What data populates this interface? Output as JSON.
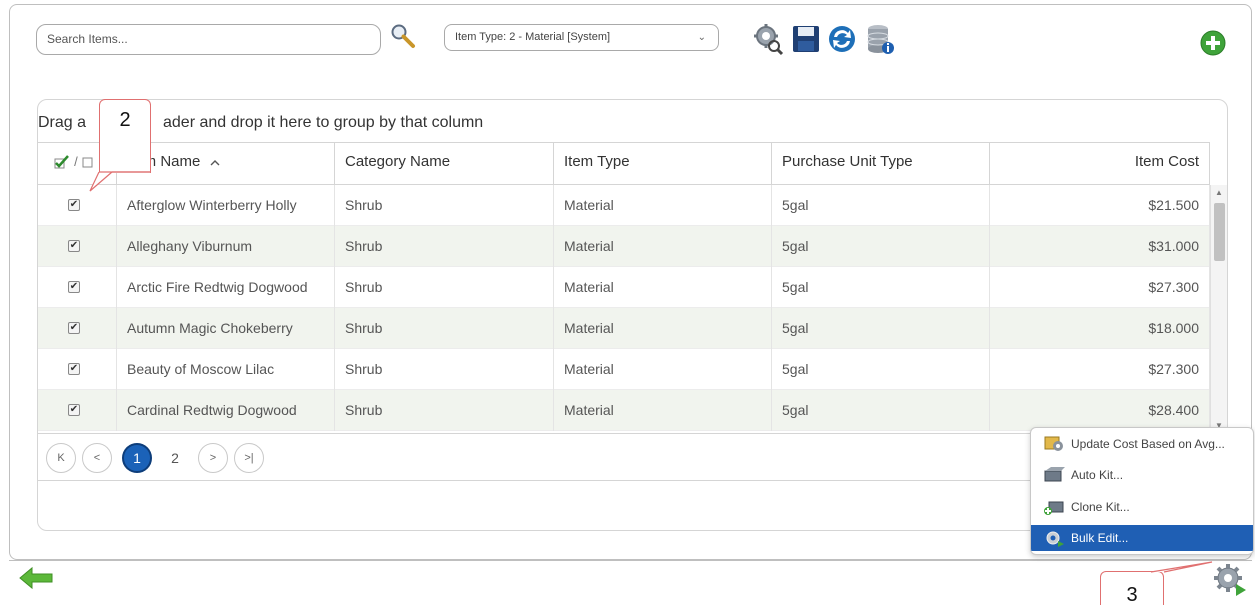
{
  "toolbar": {
    "search_placeholder": "Search Items...",
    "item_type_value": "Item Type: 2 - Material [System]"
  },
  "grid": {
    "group_hint_left": "Drag a",
    "group_hint_right": "ader and drop it here to group by that column",
    "header_select_separator": "/",
    "columns": [
      "Item Name",
      "Category Name",
      "Item Type",
      "Purchase Unit Type",
      "Item Cost"
    ],
    "sort_indicator": "^",
    "rows": [
      {
        "name": "Afterglow Winterberry Holly",
        "category": "Shrub",
        "type": "Material",
        "unit": "5gal",
        "cost": "$21.500"
      },
      {
        "name": "Alleghany Viburnum",
        "category": "Shrub",
        "type": "Material",
        "unit": "5gal",
        "cost": "$31.000"
      },
      {
        "name": "Arctic Fire Redtwig Dogwood",
        "category": "Shrub",
        "type": "Material",
        "unit": "5gal",
        "cost": "$27.300"
      },
      {
        "name": "Autumn Magic Chokeberry",
        "category": "Shrub",
        "type": "Material",
        "unit": "5gal",
        "cost": "$18.000"
      },
      {
        "name": "Beauty of Moscow Lilac",
        "category": "Shrub",
        "type": "Material",
        "unit": "5gal",
        "cost": "$27.300"
      },
      {
        "name": "Cardinal Redtwig Dogwood",
        "category": "Shrub",
        "type": "Material",
        "unit": "5gal",
        "cost": "$28.400"
      }
    ],
    "checkbox_glyph": "✔"
  },
  "pager": {
    "first": "K",
    "prev": "<",
    "next": ">",
    "last": ">|",
    "pages": [
      "1",
      "2"
    ],
    "current": "1"
  },
  "callouts": {
    "step2": "2",
    "step3": "3"
  },
  "context_menu": {
    "items": [
      {
        "label": "Update Cost Based on Avg...",
        "icon": "cost-update-icon"
      },
      {
        "label": "Auto Kit...",
        "icon": "auto-kit-icon"
      },
      {
        "label": "Clone Kit...",
        "icon": "clone-kit-icon"
      },
      {
        "label": "Bulk Edit...",
        "icon": "bulk-edit-gear-icon",
        "selected": true
      }
    ]
  },
  "colors": {
    "accent": "#1f5fb4",
    "row_alt": "#f1f4ee",
    "callout_border": "#e07070",
    "add_green": "#3fa33a"
  }
}
